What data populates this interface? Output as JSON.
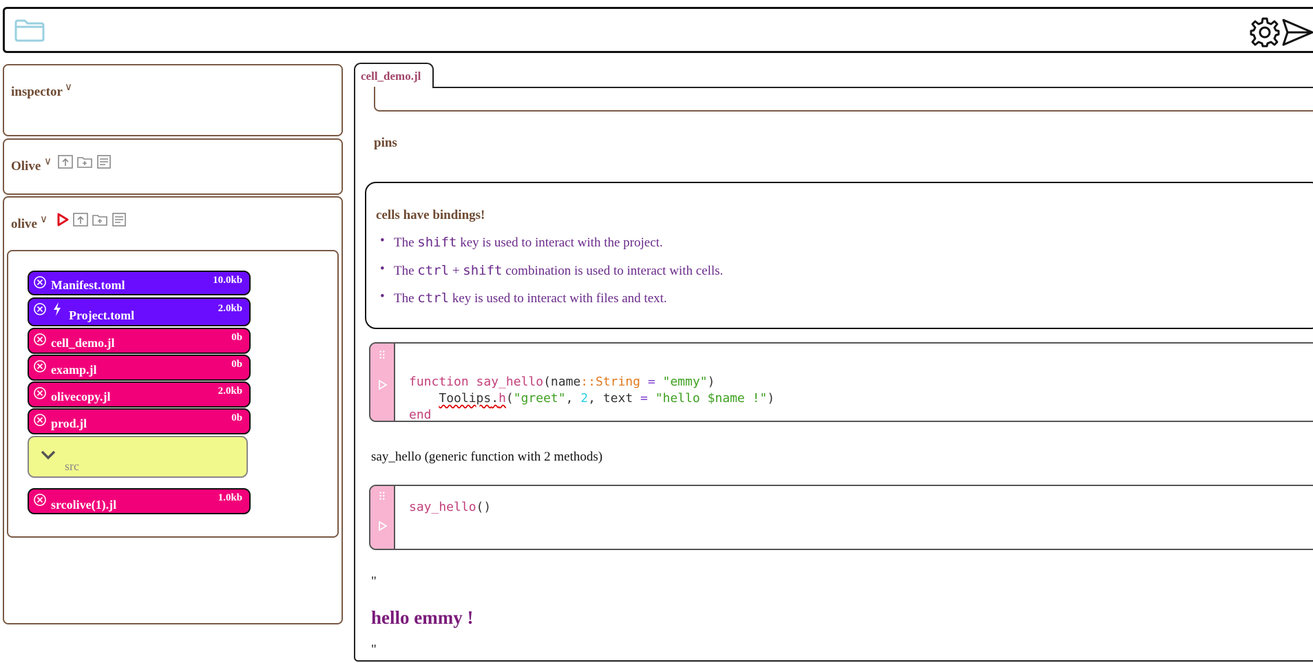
{
  "topbar": {
    "icons": [
      "folder-icon",
      "settings-gear-icon",
      "send-icon"
    ]
  },
  "sidebar": {
    "inspector": {
      "title": "inspector"
    },
    "olive_env": {
      "title": "Olive"
    },
    "olive_project": {
      "title": "olive"
    },
    "files": [
      {
        "name": "Manifest.toml",
        "size": "10.0kb",
        "color": "#6a0dff"
      },
      {
        "name": "Project.toml",
        "size": "2.0kb",
        "color": "#6a0dff",
        "has_bolt": true
      },
      {
        "name": "cell_demo.jl",
        "size": "0b",
        "color": "#f2007a"
      },
      {
        "name": "examp.jl",
        "size": "0b",
        "color": "#f2007a"
      },
      {
        "name": "olivecopy.jl",
        "size": "2.0kb",
        "color": "#f2007a"
      },
      {
        "name": "prod.jl",
        "size": "0b",
        "color": "#f2007a"
      }
    ],
    "folder": {
      "name": "src",
      "color": "#f2f98c"
    },
    "files_after": [
      {
        "name": "srcolive(1).jl",
        "size": "1.0kb",
        "color": "#f2007a"
      }
    ]
  },
  "main": {
    "tab_label": "cell_demo.jl",
    "pins_label": "pins",
    "markdown": {
      "heading": "cells have bindings!",
      "bullets": [
        {
          "pre": "The ",
          "code1": "shift",
          "post": " key is used to interact with the project."
        },
        {
          "pre": "The ",
          "code1": "ctrl",
          "mid": " + ",
          "code2": "shift",
          "post": " combination is used to interact with cells."
        },
        {
          "pre": "The ",
          "code1": "ctrl",
          "post": " key is used to interact with files and text."
        }
      ]
    },
    "code_cell_1": {
      "line1_kw": "function",
      "line1_fn": "say_hello",
      "line1_p1": "(name",
      "line1_ty": "::String",
      "line1_eq": " = ",
      "line1_str": "\"emmy\"",
      "line1_close": ")",
      "line2_indent": "    ",
      "line2_mod": "Toolips",
      "line2_dot": ".",
      "line2_fn": "h",
      "line2_p": "(",
      "line2_str1": "\"greet\"",
      "line2_c1": ", ",
      "line2_num": "2",
      "line2_c2": ", text ",
      "line2_eq": "=",
      "line2_sp": " ",
      "line2_str2": "\"hello $name !\"",
      "line2_close": ")",
      "line3_kw": "end"
    },
    "output_1": "say_hello (generic function with 2 methods)",
    "code_cell_2": {
      "fn": "say_hello",
      "args": "()"
    },
    "output_2": {
      "quote_open": "\"",
      "heading": "hello emmy !",
      "heading_color": "#7a1a7a",
      "quote_close": "\""
    }
  }
}
